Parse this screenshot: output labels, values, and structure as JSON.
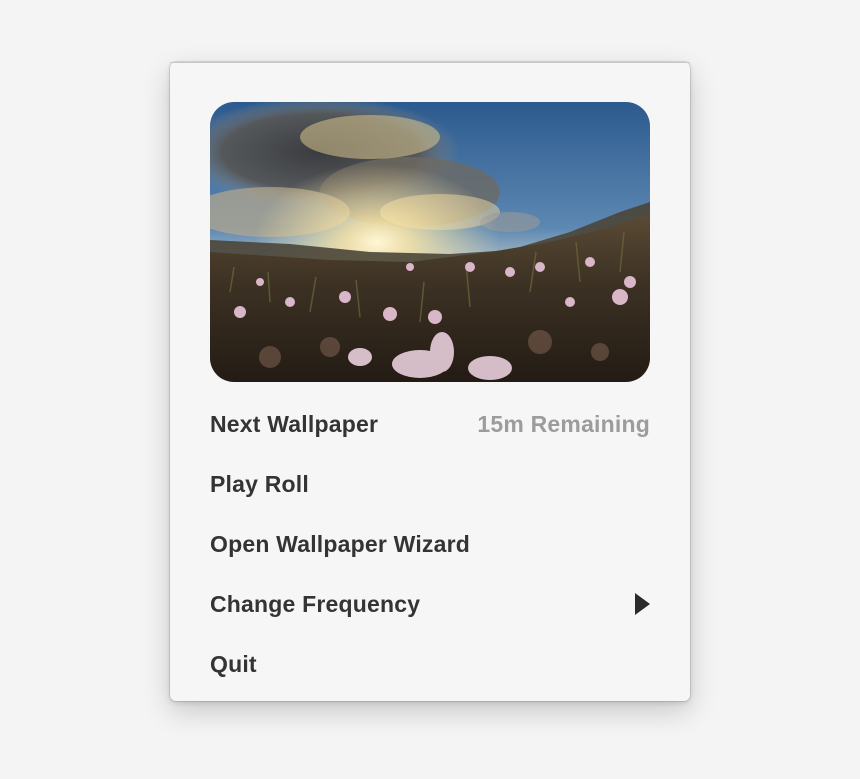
{
  "menu": {
    "preview_image": "sunset-wildflowers-wallpaper",
    "items": [
      {
        "label": "Next Wallpaper",
        "meta": "15m Remaining"
      },
      {
        "label": "Play Roll"
      },
      {
        "label": "Open Wallpaper Wizard"
      },
      {
        "label": "Change Frequency",
        "icon": "submenu-arrow-icon"
      },
      {
        "label": "Quit"
      }
    ]
  },
  "colors": {
    "menu_background": "#f6f6f6",
    "label_text": "#343434",
    "meta_text": "#9c9c9c",
    "arrow": "#2b2b2b"
  }
}
